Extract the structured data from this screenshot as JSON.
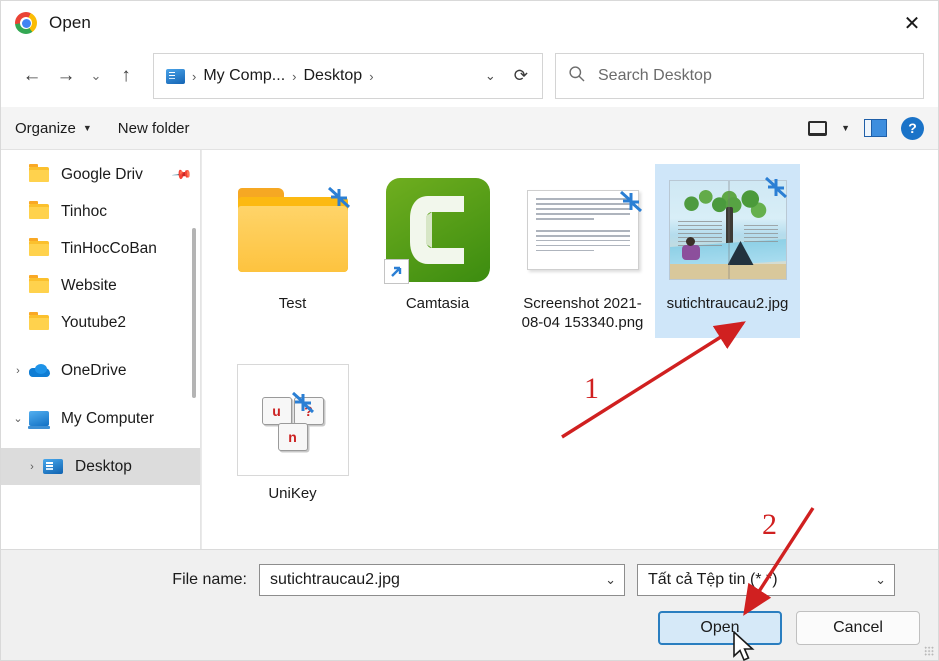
{
  "window": {
    "title": "Open",
    "app_icon": "chrome-logo",
    "close_label": "✕"
  },
  "nav": {
    "back": "←",
    "forward": "→",
    "recent": "⌄",
    "up": "↑",
    "breadcrumb": {
      "root_icon": "my-computer-icon",
      "items": [
        "My Comp...",
        "Desktop"
      ],
      "separator": "›",
      "dropdown": "⌄",
      "refresh": "⟳"
    },
    "search": {
      "placeholder": "Search Desktop",
      "icon": "search-icon"
    }
  },
  "toolbar": {
    "organize_label": "Organize",
    "organize_caret": "▼",
    "new_folder_label": "New folder",
    "view_caret": "▼",
    "icons": [
      "view-layout-icon",
      "preview-pane-icon",
      "help-icon"
    ],
    "help_glyph": "?"
  },
  "sidebar": {
    "items": [
      {
        "label": "Google Driv",
        "icon": "folder-icon",
        "expander": "",
        "pinned": true,
        "selected": false
      },
      {
        "label": "Tinhoc",
        "icon": "folder-icon",
        "expander": "",
        "pinned": false,
        "selected": false
      },
      {
        "label": "TinHocCoBan",
        "icon": "folder-icon",
        "expander": "",
        "pinned": false,
        "selected": false
      },
      {
        "label": "Website",
        "icon": "folder-icon",
        "expander": "",
        "pinned": false,
        "selected": false
      },
      {
        "label": "Youtube2",
        "icon": "folder-icon",
        "expander": "",
        "pinned": false,
        "selected": false
      },
      {
        "label": "OneDrive",
        "icon": "onedrive-cloud-icon",
        "expander": "›",
        "pinned": false,
        "selected": false
      },
      {
        "label": "My Computer",
        "icon": "my-computer-icon",
        "expander": "⌄",
        "pinned": false,
        "selected": false
      },
      {
        "label": "Desktop",
        "icon": "desktop-icon",
        "expander": "›",
        "pinned": false,
        "selected": true
      }
    ]
  },
  "files": [
    {
      "name": "Test",
      "kind": "folder",
      "overlay": "onedrive-sync-icon",
      "selected": false
    },
    {
      "name": "Camtasia",
      "kind": "app-camtasia",
      "overlay": "shortcut-arrow-icon",
      "selected": false
    },
    {
      "name": "Screenshot 2021-08-04 153340.png",
      "kind": "image-document",
      "overlay": "onedrive-sync-icon",
      "selected": false
    },
    {
      "name": "sutichtraucau2.jpg",
      "kind": "image-picture",
      "overlay": "onedrive-sync-icon",
      "selected": true
    },
    {
      "name": "UniKey",
      "kind": "app-unikey",
      "overlay": "onedrive-sync-icon",
      "selected": false
    }
  ],
  "unikey_keys": [
    "u",
    "?",
    "n"
  ],
  "footer": {
    "file_name_label": "File name:",
    "file_name_value": "sutichtraucau2.jpg",
    "file_name_chevron": "⌄",
    "filter_value": "Tất cả Tệp tin (*.*)",
    "filter_chevron": "⌄",
    "open_label": "Open",
    "cancel_label": "Cancel"
  },
  "annotations": {
    "step_one": "1",
    "step_two": "2",
    "color": "#d02020"
  },
  "colors": {
    "selection_blue": "#cfe6f9",
    "primary_border": "#2a7ec0",
    "toolbar_bg": "#f4f4f4",
    "footer_bg": "#f0f0f0"
  }
}
